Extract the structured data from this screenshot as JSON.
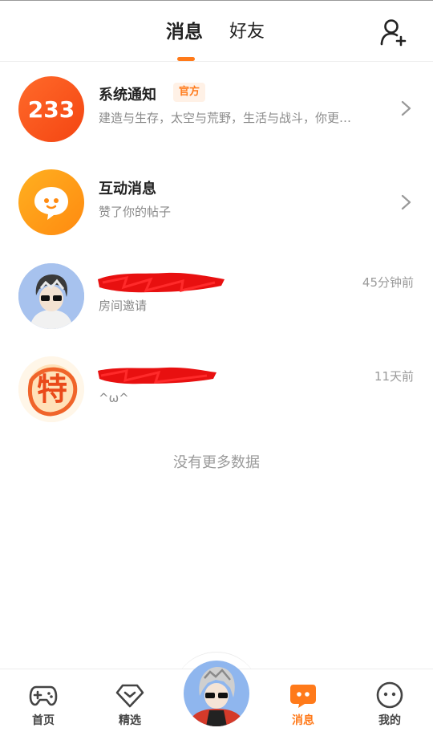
{
  "header": {
    "tabs": [
      {
        "label": "消息",
        "active": true
      },
      {
        "label": "好友",
        "active": false
      }
    ]
  },
  "conversations": [
    {
      "title": "系统通知",
      "badge": "官方",
      "subtitle": "建造与生存，太空与荒野，生活与战斗，你更…",
      "avatar_text": "233"
    },
    {
      "title": "互动消息",
      "subtitle": "赞了你的帖子"
    },
    {
      "title": "",
      "subtitle": "房间邀请",
      "time": "45分钟前"
    },
    {
      "title": "",
      "subtitle": "^ω^",
      "time": "11天前",
      "avatar_text": "特"
    }
  ],
  "empty_note": "没有更多数据",
  "bottom_nav": [
    {
      "label": "首页"
    },
    {
      "label": "精选"
    },
    {
      "label": "消息",
      "active": true
    },
    {
      "label": "我的"
    }
  ],
  "colors": {
    "accent": "#ff7a1a",
    "redaction": "#e81010"
  }
}
